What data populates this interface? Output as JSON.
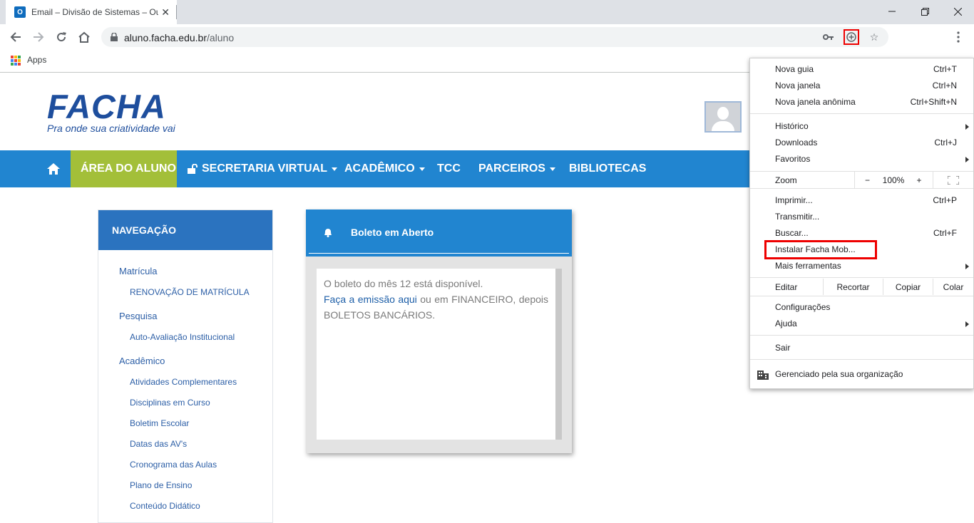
{
  "browser": {
    "tab_title": "Email – Divisão de Sistemas – Ou",
    "tab_favicon": "O",
    "url_host": "aluno.facha.edu.br",
    "url_path": "/aluno",
    "bookmarks_apps": "Apps"
  },
  "site": {
    "logo": "FACHA",
    "tagline": "Pra onde sua criatividade vai",
    "nav": {
      "area": "ÁREA DO ALUNO",
      "secretaria": "SECRETARIA VIRTUAL",
      "academico": "ACADÊMICO",
      "tcc": "TCC",
      "parceiros": "PARCEIROS",
      "bibliotecas": "BIBLIOTECAS"
    },
    "sidebar": {
      "title": "NAVEGAÇÃO",
      "groups": {
        "matricula": "Matrícula",
        "pesquisa": "Pesquisa",
        "academico": "Acadêmico"
      },
      "items": {
        "renovacao": "RENOVAÇÃO DE MATRÍCULA",
        "auto_avaliacao": "Auto-Avaliação Institucional",
        "atividades": "Atividades Complementares",
        "disciplinas": "Disciplinas em Curso",
        "boletim": "Boletim Escolar",
        "datas_av": "Datas das AV's",
        "cronograma": "Cronograma das Aulas",
        "plano": "Plano de Ensino",
        "conteudo": "Conteúdo Didático"
      }
    },
    "card": {
      "title": "Boleto em Aberto",
      "line1": "O boleto do mês 12 está disponível.",
      "link": "Faça a emissão aqui",
      "line2_rest": " ou em FINANCEIRO, depois BOLETOS BANCÁRIOS."
    }
  },
  "menu": {
    "nova_guia": "Nova guia",
    "nova_guia_sc": "Ctrl+T",
    "nova_janela": "Nova janela",
    "nova_janela_sc": "Ctrl+N",
    "anonima": "Nova janela anônima",
    "anonima_sc": "Ctrl+Shift+N",
    "historico": "Histórico",
    "downloads": "Downloads",
    "downloads_sc": "Ctrl+J",
    "favoritos": "Favoritos",
    "zoom": "Zoom",
    "zoom_minus": "−",
    "zoom_value": "100%",
    "zoom_plus": "+",
    "imprimir": "Imprimir...",
    "imprimir_sc": "Ctrl+P",
    "transmitir": "Transmitir...",
    "buscar": "Buscar...",
    "buscar_sc": "Ctrl+F",
    "instalar": "Instalar Facha Mob...",
    "mais_ferramentas": "Mais ferramentas",
    "editar": "Editar",
    "recortar": "Recortar",
    "copiar": "Copiar",
    "colar": "Colar",
    "configuracoes": "Configurações",
    "ajuda": "Ajuda",
    "sair": "Sair",
    "gerenciado": "Gerenciado pela sua organização"
  },
  "colors": {
    "nav_blue": "#2185d0",
    "active_green": "#a3bf39",
    "logo_blue": "#1e4e9d",
    "highlight_red": "#e00000"
  }
}
